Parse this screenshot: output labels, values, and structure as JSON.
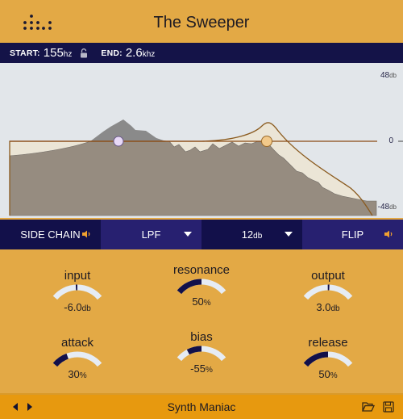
{
  "app": {
    "title": "The Sweeper"
  },
  "range": {
    "start_label": "START:",
    "start_value": "155",
    "start_unit": "hz",
    "lock_icon": "unlocked-padlock-icon",
    "end_label": "END:",
    "end_value": "2.6",
    "end_unit": "khz"
  },
  "graph": {
    "axis_top": "48",
    "axis_top_unit": "db",
    "axis_mid": "0",
    "axis_bottom": "-48",
    "axis_bottom_unit": "db",
    "handles": [
      {
        "name": "start-handle",
        "color": "#e8d9f7"
      },
      {
        "name": "end-handle",
        "color": "#f2c98a"
      }
    ],
    "colors": {
      "spectrum": "#948a7e",
      "spectrum_peak": "#8a8a8a",
      "filter_fill": "#ebe5d6",
      "filter_line": "#8a5a1e"
    }
  },
  "controls": {
    "side_chain_label": "SIDE CHAIN",
    "filter_type": "LPF",
    "slope_value": "12",
    "slope_unit": "db",
    "flip_label": "FLIP"
  },
  "knobs": [
    {
      "id": "input",
      "label": "input",
      "value": "-6.0",
      "unit": "db",
      "type": "bipolar",
      "level": -0.03
    },
    {
      "id": "resonance",
      "label": "resonance",
      "value": "50",
      "unit": "%",
      "type": "unipolar",
      "level": 0.5
    },
    {
      "id": "output",
      "label": "output",
      "value": "3.0",
      "unit": "db",
      "type": "bipolar",
      "level": 0.02
    },
    {
      "id": "attack",
      "label": "attack",
      "value": "30",
      "unit": "%",
      "type": "unipolar",
      "level": 0.3
    },
    {
      "id": "bias",
      "label": "bias",
      "value": "-55",
      "unit": "%",
      "type": "bipolar",
      "level": -0.55
    },
    {
      "id": "release",
      "label": "release",
      "value": "50",
      "unit": "%",
      "type": "unipolar",
      "level": 0.5
    }
  ],
  "footer": {
    "preset_name": "Synth Maniac",
    "prev_icon": "prev-preset-icon",
    "next_icon": "next-preset-icon",
    "open_icon": "folder-open-icon",
    "save_icon": "save-icon"
  },
  "theme": {
    "background": "#e3a945",
    "navy": "#12104a",
    "navy_light": "#272070",
    "accent_orange": "#f0a030",
    "knob_track": "#e6ecf4",
    "knob_fill": "#12104a"
  }
}
